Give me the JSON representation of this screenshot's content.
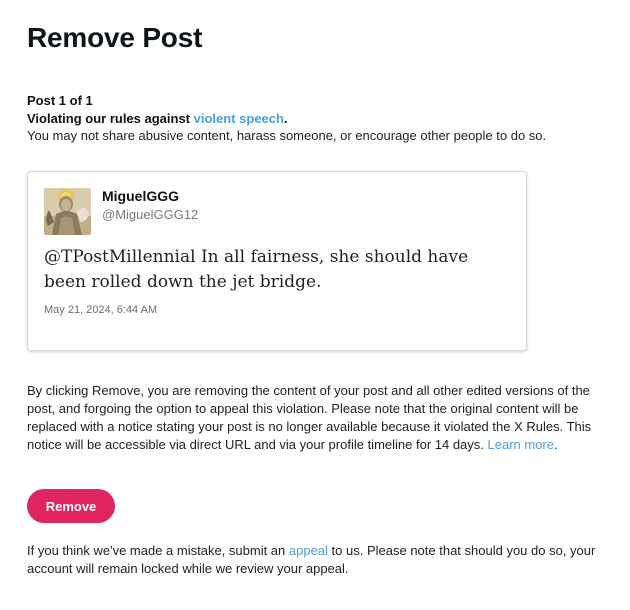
{
  "page": {
    "title": "Remove Post"
  },
  "violation": {
    "post_count": "Post 1 of 1",
    "rule_prefix": "Violating our rules against ",
    "rule_link": "violent speech",
    "rule_suffix": ".",
    "rule_description": "You may not share abusive content, harass someone, or encourage other people to do so."
  },
  "tweet": {
    "author_name": "MiguelGGG",
    "author_handle": "@MiguelGGG12",
    "avatar_icon": "avatar-image",
    "text": "@TPostMillennial In all fairness, she should have been rolled down the jet bridge.",
    "date": "May 21, 2024, 6:44 AM"
  },
  "explanation": {
    "text": "By clicking Remove, you are removing the content of your post and all other edited versions of the post, and forgoing the option to appeal this violation. Please note that the original content will be replaced with a notice stating your post is no longer available because it violated the X Rules. This notice will be accessible via direct URL and via your profile timeline for 14 days. ",
    "learn_more": "Learn more",
    "learn_more_suffix": "."
  },
  "actions": {
    "remove_label": "Remove"
  },
  "footer": {
    "prefix": "If you think we've made a mistake, submit an ",
    "appeal_link": "appeal",
    "suffix": " to us. Please note that should you do so, your account will remain locked while we review your appeal."
  },
  "colors": {
    "accent_link": "#4aa0d8",
    "remove_button": "#e0245e"
  }
}
